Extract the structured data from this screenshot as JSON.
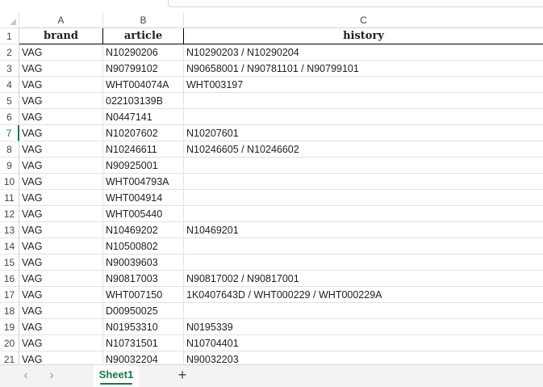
{
  "columns": [
    "A",
    "B",
    "C"
  ],
  "header": {
    "row_number": "1",
    "brand": "brand",
    "article": "article",
    "history": "history"
  },
  "rows": [
    {
      "n": "2",
      "brand": "VAG",
      "article": "N10290206",
      "history": "N10290203 / N10290204"
    },
    {
      "n": "3",
      "brand": "VAG",
      "article": "N90799102",
      "history": "N90658001 / N90781101 / N90799101"
    },
    {
      "n": "4",
      "brand": "VAG",
      "article": "WHT004074A",
      "history": "WHT003197"
    },
    {
      "n": "5",
      "brand": "VAG",
      "article": "022103139B",
      "history": ""
    },
    {
      "n": "6",
      "brand": "VAG",
      "article": "N0447141",
      "history": ""
    },
    {
      "n": "7",
      "brand": "VAG",
      "article": "N10207602",
      "history": "N10207601"
    },
    {
      "n": "8",
      "brand": "VAG",
      "article": "N10246611",
      "history": "N10246605 / N10246602"
    },
    {
      "n": "9",
      "brand": "VAG",
      "article": "N90925001",
      "history": ""
    },
    {
      "n": "10",
      "brand": "VAG",
      "article": "WHT004793A",
      "history": ""
    },
    {
      "n": "11",
      "brand": "VAG",
      "article": "WHT004914",
      "history": ""
    },
    {
      "n": "12",
      "brand": "VAG",
      "article": "WHT005440",
      "history": ""
    },
    {
      "n": "13",
      "brand": "VAG",
      "article": "N10469202",
      "history": "N10469201"
    },
    {
      "n": "14",
      "brand": "VAG",
      "article": "N10500802",
      "history": ""
    },
    {
      "n": "15",
      "brand": "VAG",
      "article": "N90039603",
      "history": ""
    },
    {
      "n": "16",
      "brand": "VAG",
      "article": "N90817003",
      "history": "N90817002 / N90817001"
    },
    {
      "n": "17",
      "brand": "VAG",
      "article": "WHT007150",
      "history": "1K0407643D / WHT000229 / WHT000229A"
    },
    {
      "n": "18",
      "brand": "VAG",
      "article": "D00950025",
      "history": ""
    },
    {
      "n": "19",
      "brand": "VAG",
      "article": "N01953310",
      "history": "N0195339"
    },
    {
      "n": "20",
      "brand": "VAG",
      "article": "N10731501",
      "history": "N10704401"
    },
    {
      "n": "21",
      "brand": "VAG",
      "article": "N90032204",
      "history": "N90032203"
    }
  ],
  "active_row": "7",
  "sheet_tabs": [
    "Sheet1"
  ],
  "footer": {
    "prev_icon": "chevron-left-icon",
    "next_icon": "chevron-right-icon",
    "add_icon": "plus-icon",
    "prev_glyph": "‹",
    "next_glyph": "›",
    "add_glyph": "+"
  },
  "colors": {
    "accent": "#107c41",
    "gridline": "#e1e1e1"
  }
}
